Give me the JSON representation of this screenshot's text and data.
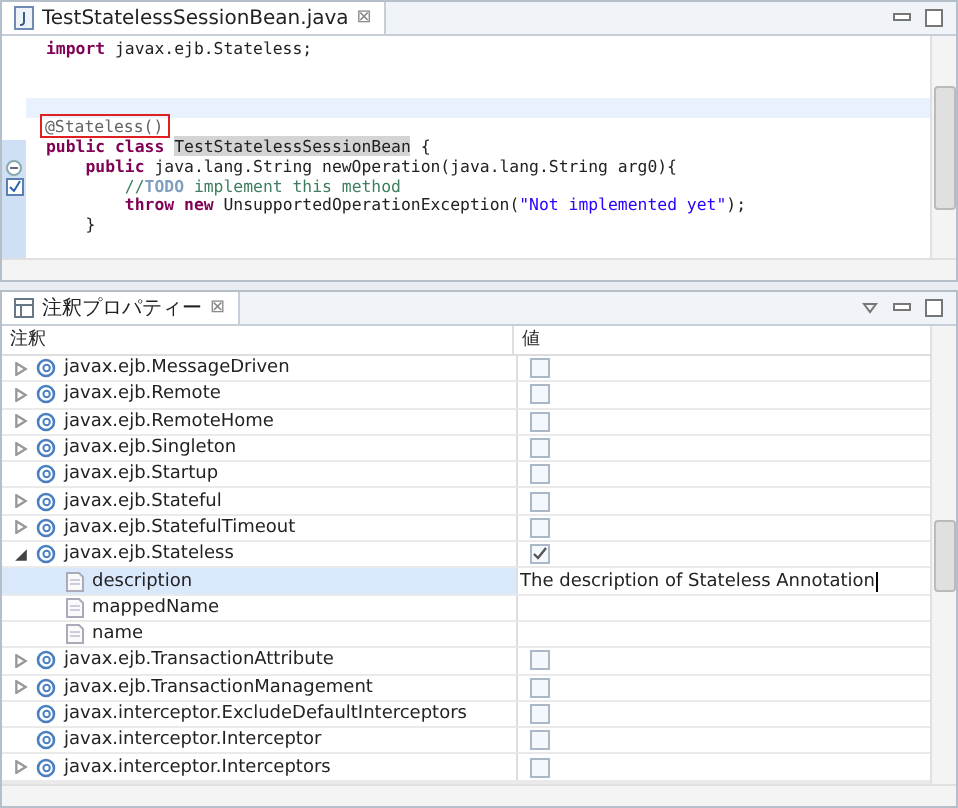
{
  "editor": {
    "tab_title": "TestStatelessSessionBean.java",
    "tab_close": "⊠",
    "lines": [
      {
        "tokens": [
          {
            "kind": "kw",
            "text": "import"
          },
          {
            "kind": "text",
            "text": " javax.ejb.Stateless;"
          }
        ]
      },
      {
        "kind": "blank"
      },
      {
        "kind": "blank"
      },
      {
        "kind": "blank",
        "current": true
      },
      {
        "boxed": true,
        "tokens": [
          {
            "kind": "annot",
            "text": "@Stateless()"
          }
        ]
      },
      {
        "tokens": [
          {
            "kind": "kw",
            "text": "public class "
          },
          {
            "kind": "occurrence",
            "text": "TestStatelessSessionBean"
          },
          {
            "kind": "text",
            "text": " {"
          }
        ]
      },
      {
        "fold": true,
        "tokens": [
          {
            "kind": "kw",
            "text": "    public"
          },
          {
            "kind": "text",
            "text": " java.lang.String newOperation(java.lang.String arg0){"
          }
        ]
      },
      {
        "marker": true,
        "tokens": [
          {
            "kind": "comment",
            "text": "        //"
          },
          {
            "kind": "todo",
            "text": "TODO"
          },
          {
            "kind": "comment",
            "text": " implement this method"
          }
        ]
      },
      {
        "tokens": [
          {
            "kind": "kw",
            "text": "        throw new"
          },
          {
            "kind": "text",
            "text": " UnsupportedOperationException("
          },
          {
            "kind": "string",
            "text": "\"Not implemented yet\""
          },
          {
            "kind": "text",
            "text": ");"
          }
        ]
      },
      {
        "tokens": [
          {
            "kind": "text",
            "text": "    }"
          }
        ]
      }
    ]
  },
  "panel": {
    "title": "注釈プロパティー",
    "tab_close": "⊠",
    "columns": [
      "注釈",
      "値"
    ],
    "rows": [
      {
        "kind": "annotation",
        "label": "javax.ejb.MessageDriven",
        "expandable": true,
        "expanded": false,
        "checked": false,
        "selected": false
      },
      {
        "kind": "annotation",
        "label": "javax.ejb.Remote",
        "expandable": true,
        "expanded": false,
        "checked": false,
        "selected": false
      },
      {
        "kind": "annotation",
        "label": "javax.ejb.RemoteHome",
        "expandable": true,
        "expanded": false,
        "checked": false,
        "selected": false
      },
      {
        "kind": "annotation",
        "label": "javax.ejb.Singleton",
        "expandable": true,
        "expanded": false,
        "checked": false,
        "selected": false
      },
      {
        "kind": "annotation",
        "label": "javax.ejb.Startup",
        "expandable": false,
        "checked": false,
        "selected": false
      },
      {
        "kind": "annotation",
        "label": "javax.ejb.Stateful",
        "expandable": true,
        "expanded": false,
        "checked": false,
        "selected": false
      },
      {
        "kind": "annotation",
        "label": "javax.ejb.StatefulTimeout",
        "expandable": true,
        "expanded": false,
        "checked": false,
        "selected": false
      },
      {
        "kind": "annotation",
        "label": "javax.ejb.Stateless",
        "expandable": true,
        "expanded": true,
        "checked": true,
        "selected": false,
        "children": [
          {
            "kind": "attribute",
            "label": "description",
            "value": "The description of Stateless Annotation",
            "selected": true
          },
          {
            "kind": "attribute",
            "label": "mappedName",
            "selected": false
          },
          {
            "kind": "attribute",
            "label": "name",
            "selected": false
          }
        ]
      },
      {
        "kind": "annotation",
        "label": "javax.ejb.TransactionAttribute",
        "expandable": true,
        "expanded": false,
        "checked": false,
        "selected": false
      },
      {
        "kind": "annotation",
        "label": "javax.ejb.TransactionManagement",
        "expandable": true,
        "expanded": false,
        "checked": false,
        "selected": false
      },
      {
        "kind": "annotation",
        "label": "javax.interceptor.ExcludeDefaultInterceptors",
        "expandable": false,
        "checked": false,
        "selected": false
      },
      {
        "kind": "annotation",
        "label": "javax.interceptor.Interceptor",
        "expandable": false,
        "checked": false,
        "selected": false
      },
      {
        "kind": "annotation",
        "label": "javax.interceptor.Interceptors",
        "expandable": true,
        "expanded": false,
        "checked": false,
        "selected": false
      }
    ]
  }
}
